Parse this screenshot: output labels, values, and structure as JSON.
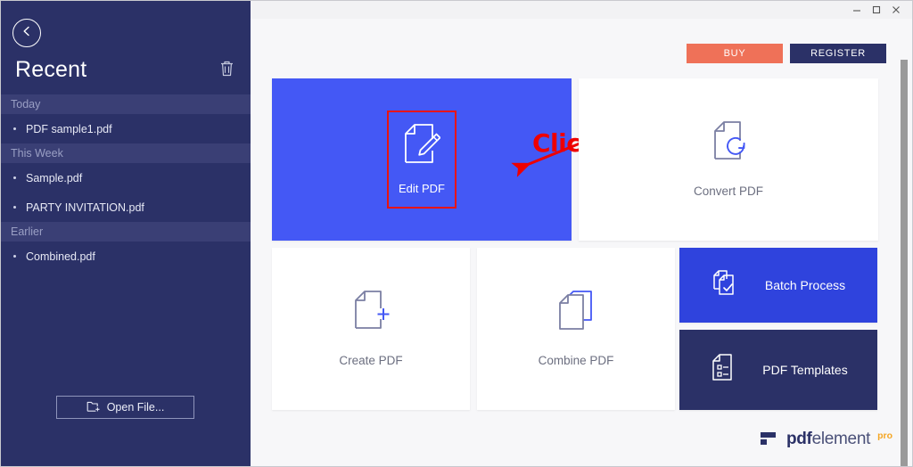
{
  "window": {
    "minimize_label": "–",
    "maximize_label": "□",
    "close_label": "×"
  },
  "sidebar": {
    "back_icon": "chevron-left-icon",
    "title": "Recent",
    "clear_icon": "trash-icon",
    "sections": [
      {
        "label": "Today",
        "files": [
          "PDF sample1.pdf"
        ]
      },
      {
        "label": "This Week",
        "files": [
          "Sample.pdf",
          "PARTY INVITATION.pdf"
        ]
      },
      {
        "label": "Earlier",
        "files": [
          "Combined.pdf"
        ]
      }
    ],
    "open_file_label": "Open File...",
    "open_file_icon": "folder-plus-icon",
    "bg_color": "#2b3167",
    "section_bg_color": "#3a3f75"
  },
  "topbar": {
    "buy_label": "BUY",
    "register_label": "REGISTER",
    "buy_color": "#ef7158",
    "register_color": "#2b3167"
  },
  "tiles": {
    "edit": {
      "label": "Edit PDF",
      "icon": "document-pencil-icon",
      "color": "#4458f5"
    },
    "convert": {
      "label": "Convert PDF",
      "icon": "document-refresh-icon",
      "color": "#ffffff"
    },
    "create": {
      "label": "Create PDF",
      "icon": "document-plus-icon",
      "color": "#ffffff"
    },
    "combine": {
      "label": "Combine PDF",
      "icon": "two-documents-icon",
      "color": "#ffffff"
    },
    "batch": {
      "label": "Batch Process",
      "icon": "document-check-icon",
      "color": "#2f43dd"
    },
    "templates": {
      "label": "PDF Templates",
      "icon": "document-list-icon",
      "color": "#2b3167"
    }
  },
  "annotation": {
    "text": "Click",
    "color": "#ee0000",
    "shape": "arrow-pointing-left"
  },
  "logo": {
    "bold_part": "pdf",
    "light_part": "element",
    "badge": "pro",
    "badge_color": "#f5a623"
  }
}
